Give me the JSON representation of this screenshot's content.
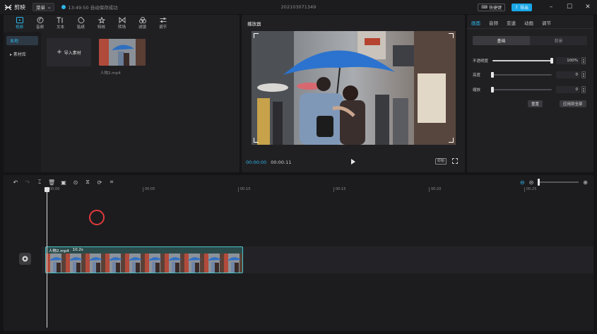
{
  "titlebar": {
    "app_name": "剪映",
    "menu_label": "菜单",
    "save_status": "13:49:50 自动保存成功",
    "project_name": "202103071349",
    "shortcut_label": "快捷键",
    "export_label": "导出"
  },
  "colors": {
    "accent": "#2fb5e8",
    "clip_border": "#49c6c9",
    "cursor_ring": "#e03a3a"
  },
  "toolbar": {
    "items": [
      {
        "label": "视频",
        "icon": "video-icon"
      },
      {
        "label": "音频",
        "icon": "audio-icon"
      },
      {
        "label": "文本",
        "icon": "text-icon"
      },
      {
        "label": "贴纸",
        "icon": "sticker-icon"
      },
      {
        "label": "特效",
        "icon": "effects-icon"
      },
      {
        "label": "转场",
        "icon": "transition-icon"
      },
      {
        "label": "滤镜",
        "icon": "filter-icon"
      },
      {
        "label": "调节",
        "icon": "adjust-icon"
      }
    ]
  },
  "media": {
    "side_items": [
      {
        "label": "本地"
      },
      {
        "label": "▸ 素材库"
      }
    ],
    "import_label": "导入素材",
    "clip_name": "人物2.mp4"
  },
  "player": {
    "title": "播放器",
    "current_time": "00:00:00",
    "total_time": "00:00:11",
    "ratio_label": "原始"
  },
  "properties": {
    "tabs": [
      {
        "label": "画面"
      },
      {
        "label": "音频"
      },
      {
        "label": "变速"
      },
      {
        "label": "动画"
      },
      {
        "label": "调节"
      }
    ],
    "subtabs": [
      {
        "label": "基础"
      },
      {
        "label": "背景"
      }
    ],
    "opacity_label": "不透明度",
    "opacity_value": "100%",
    "opacity_level": 1.0,
    "brightness_label": "亮度",
    "brightness_value": "0",
    "brightness_level": 0,
    "zoom_label": "缩放",
    "zoom_value": "0",
    "zoom_level": 0,
    "reset_label": "重置",
    "apply_all_label": "应用到全部"
  },
  "timeline": {
    "ruler": [
      "00:00",
      "00:05",
      "00:10",
      "00:15",
      "00:20",
      "00:25"
    ],
    "clip_name": "人物2.mp4",
    "clip_duration": "10.2s"
  }
}
